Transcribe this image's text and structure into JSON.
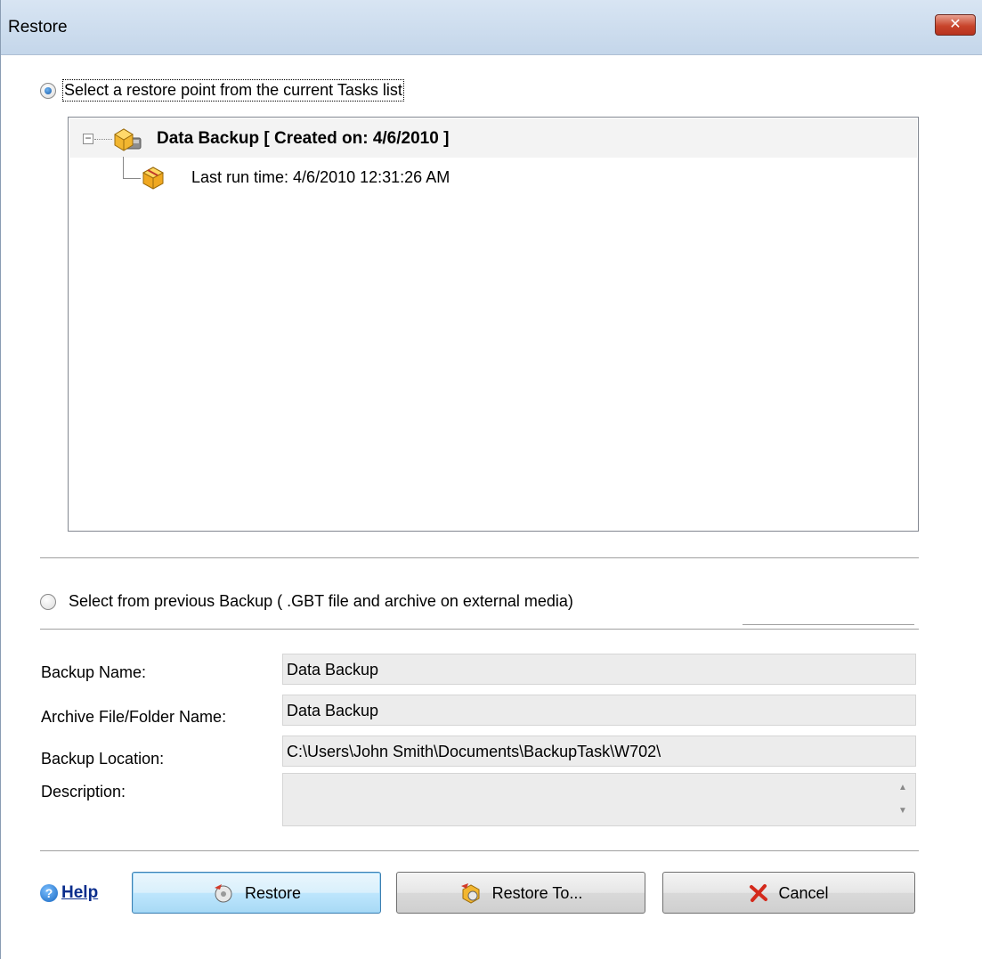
{
  "window": {
    "title": "Restore",
    "close_label": "✕"
  },
  "options": {
    "tasks_list_label": "Select a restore point from the current Tasks list",
    "tasks_list_selected": true,
    "previous_backup_label": "Select from previous Backup ( .GBT file and archive on external media)",
    "previous_backup_selected": false
  },
  "tree": {
    "task": {
      "label": "Data Backup [  Created on: 4/6/2010 ]",
      "expander": "−",
      "icon": "backup-task-icon"
    },
    "run": {
      "label": "Last run time: 4/6/2010 12:31:26 AM",
      "icon": "backup-archive-icon"
    }
  },
  "details": {
    "backup_name_label": "Backup Name:",
    "backup_name_value": "Data Backup",
    "archive_label": "Archive File/Folder Name:",
    "archive_value": "Data Backup",
    "location_label": "Backup Location:",
    "location_value": "C:\\Users\\John Smith\\Documents\\BackupTask\\W702\\",
    "description_label": "Description:",
    "description_value": ""
  },
  "footer": {
    "help_label": "Help",
    "help_icon_glyph": "?",
    "restore_label": "Restore",
    "restore_to_label": "Restore To...",
    "cancel_label": "Cancel"
  },
  "colors": {
    "accent": "#3c7fb1",
    "link": "#0a2d8c",
    "cancel_x": "#d42a1c"
  }
}
